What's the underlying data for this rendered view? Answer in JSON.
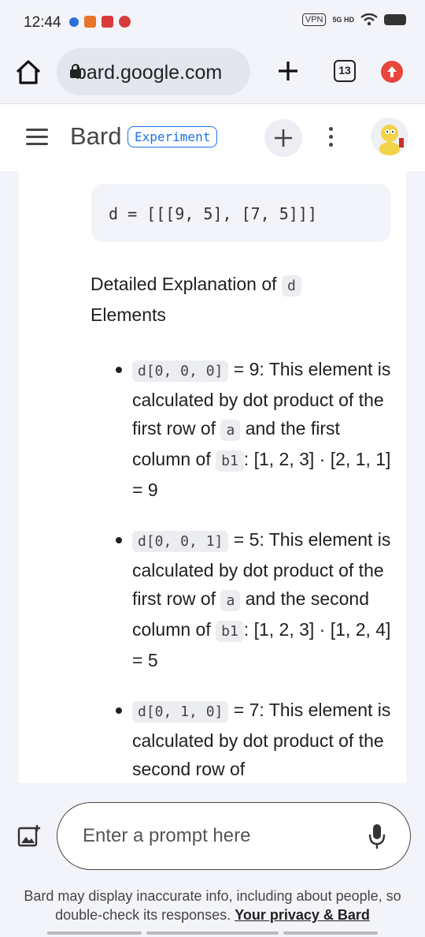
{
  "status_bar": {
    "time": "12:44",
    "vpn": "VPN",
    "network": "5G HD"
  },
  "browser": {
    "url": "bard.google.com",
    "tab_count": "13"
  },
  "header": {
    "title": "Bard",
    "badge": "Experiment"
  },
  "content": {
    "code_line": "d = [[[9, 5], [7, 5]]]",
    "heading_text": "Detailed Explanation of",
    "heading_code": "d",
    "heading_suffix": "Elements",
    "bullets": [
      {
        "code": "d[0, 0, 0]",
        "t1": " = 9: This element is calculated by dot product of the first row of ",
        "code2": "a",
        "t2": " and the first column of ",
        "code3": "b1",
        "t3": ": [1, 2, 3] · [2, 1, 1] = 9"
      },
      {
        "code": "d[0, 0, 1]",
        "t1": " = 5: This element is calculated by dot product of the first row of ",
        "code2": "a",
        "t2": " and the second column of ",
        "code3": "b1",
        "t3": ": [1, 2, 3] · [1, 2, 4] = 5"
      },
      {
        "code": "d[0, 1, 0]",
        "t1": " = 7: This element is calculated by dot product of the second row of"
      }
    ]
  },
  "prompt": {
    "placeholder": "Enter a prompt here",
    "disclaimer": "Bard may display inaccurate info, including about people, so double-check its responses. ",
    "privacy_link": "Your privacy & Bard"
  },
  "colors": {
    "accent": "#1a73e8",
    "update_badge": "#e8463a",
    "surface": "#f3f4f9"
  },
  "icons": [
    "home-icon",
    "lock-icon",
    "plus-icon",
    "tabs-icon",
    "update-icon",
    "menu-icon",
    "new-chat-icon",
    "more-vert-icon",
    "add-image-icon",
    "mic-icon"
  ]
}
